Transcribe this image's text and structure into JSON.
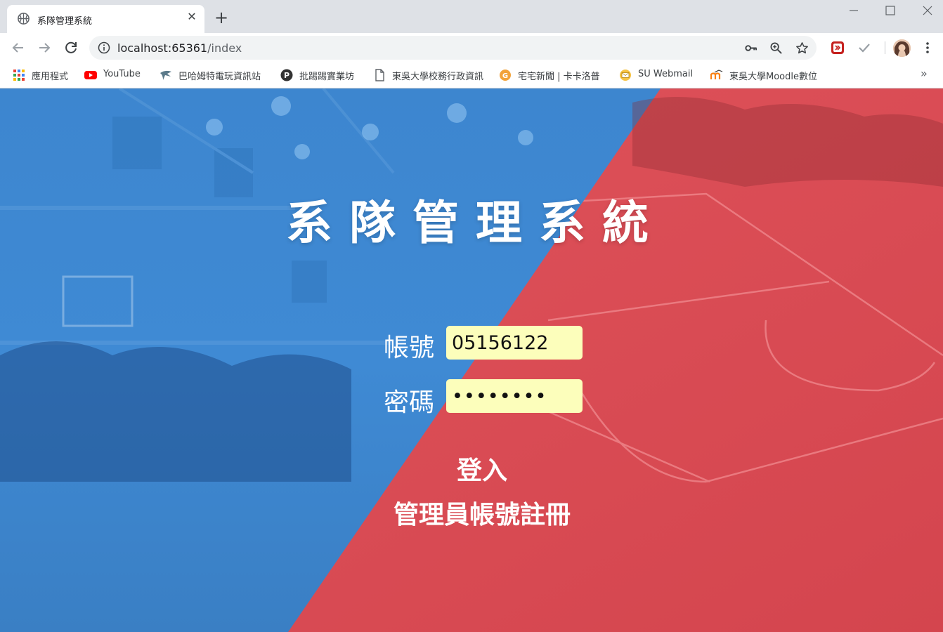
{
  "browser": {
    "tab": {
      "title": "系隊管理系統"
    },
    "url": {
      "host": "localhost:65361",
      "path": "/index"
    },
    "bookmarks": [
      {
        "label": "應用程式",
        "icon": "apps-grid-icon"
      },
      {
        "label": "YouTube",
        "icon": "youtube-icon"
      },
      {
        "label": "巴哈姆特電玩資訊站",
        "icon": "bahamut-icon"
      },
      {
        "label": "批踢踢實業坊",
        "icon": "ptt-icon"
      },
      {
        "label": "東吳大學校務行政資訊",
        "icon": "document-icon"
      },
      {
        "label": "宅宅新聞 | 卡卡洛普",
        "icon": "gamme-icon"
      },
      {
        "label": "SU Webmail",
        "icon": "webmail-icon"
      },
      {
        "label": "東吳大學Moodle數位",
        "icon": "moodle-icon"
      }
    ],
    "more_bookmarks": "»"
  },
  "page": {
    "title": "系隊管理系統",
    "account_label": "帳號",
    "account_value": "05156122",
    "password_label": "密碼",
    "password_value": "••••••••",
    "login_label": "登入",
    "register_label": "管理員帳號註冊"
  },
  "colors": {
    "blue_panel": "#3b8ad6",
    "red_panel": "#de4b55",
    "input_bg": "#fcfebb"
  }
}
